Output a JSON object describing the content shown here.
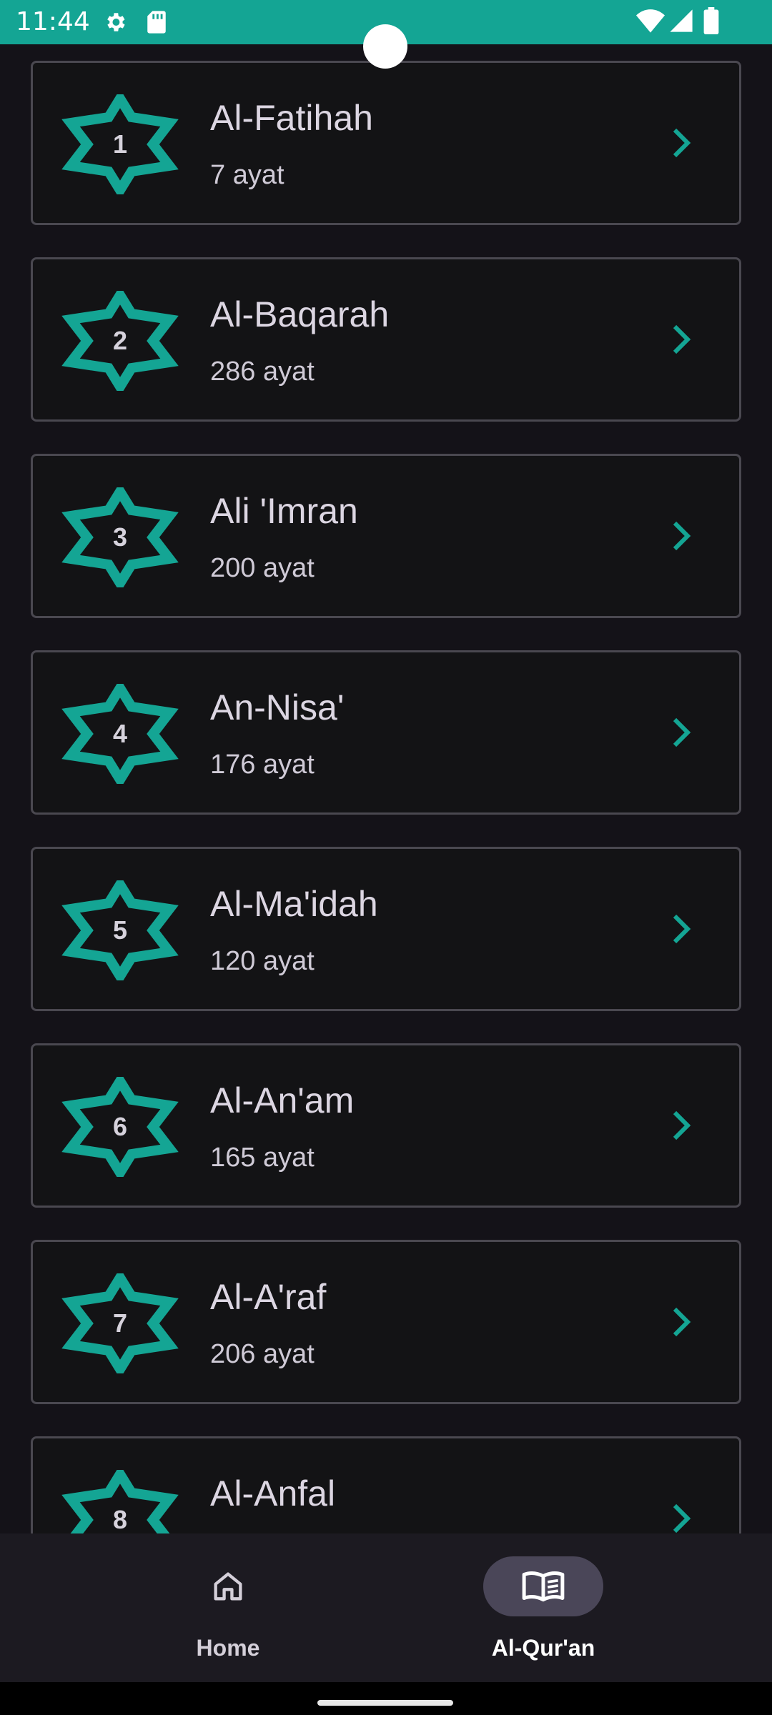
{
  "status_bar": {
    "time": "11:44",
    "left_icons": [
      "gear-icon",
      "sd-card-icon"
    ],
    "right_icons": [
      "wifi-icon",
      "signal-icon",
      "battery-icon"
    ],
    "background": "#14a594"
  },
  "theme": {
    "accent": "#14a594",
    "card_border": "#4a4850",
    "background": "#141218"
  },
  "surahs": [
    {
      "number": "1",
      "name": "Al-Fatihah",
      "ayat": "7 ayat"
    },
    {
      "number": "2",
      "name": "Al-Baqarah",
      "ayat": "286 ayat"
    },
    {
      "number": "3",
      "name": "Ali 'Imran",
      "ayat": "200 ayat"
    },
    {
      "number": "4",
      "name": "An-Nisa'",
      "ayat": "176 ayat"
    },
    {
      "number": "5",
      "name": "Al-Ma'idah",
      "ayat": "120 ayat"
    },
    {
      "number": "6",
      "name": "Al-An'am",
      "ayat": "165 ayat"
    },
    {
      "number": "7",
      "name": "Al-A'raf",
      "ayat": "206 ayat"
    },
    {
      "number": "8",
      "name": "Al-Anfal",
      "ayat": ""
    }
  ],
  "bottom_nav": {
    "items": [
      {
        "label": "Home",
        "icon": "home-icon",
        "active": false
      },
      {
        "label": "Al-Qur'an",
        "icon": "open-book-icon",
        "active": true
      }
    ]
  }
}
